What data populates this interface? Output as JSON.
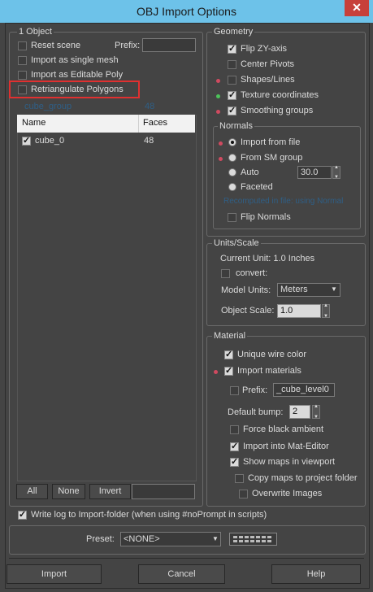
{
  "window": {
    "title": "OBJ Import Options",
    "close_glyph": "✕"
  },
  "objects": {
    "group_label": "1 Object",
    "reset_scene": "Reset scene",
    "prefix_label": "Prefix:",
    "import_single_mesh": "Import as single mesh",
    "import_editable_poly": "Import as Editable Poly",
    "retriangulate": "Retriangulate Polygons",
    "dim_left": "cube_group",
    "dim_right": "48",
    "columns": {
      "name": "Name",
      "faces": "Faces"
    },
    "rows": [
      {
        "name": "cube_0",
        "faces": "48",
        "checked": true
      }
    ],
    "all_btn": "All",
    "none_btn": "None",
    "invert_btn": "Invert"
  },
  "geometry": {
    "group_label": "Geometry",
    "flip_zy": "Flip ZY-axis",
    "center_pivots": "Center Pivots",
    "shapes_lines": "Shapes/Lines",
    "texture_coords": "Texture coordinates",
    "smoothing_groups": "Smoothing groups",
    "normals": {
      "group_label": "Normals",
      "import_from_file": "Import from file",
      "from_sm_group": "From SM group",
      "auto": "Auto",
      "auto_value": "30.0",
      "faceted": "Faceted",
      "dim_note": "Recomputed in file: using Normal",
      "flip_normals": "Flip Normals"
    }
  },
  "units": {
    "group_label": "Units/Scale",
    "current_unit": "Current Unit:  1.0 Inches",
    "convert": "convert:",
    "model_units_label": "Model Units:",
    "model_units_value": "Meters",
    "object_scale_label": "Object Scale:",
    "object_scale_value": "1.0"
  },
  "material": {
    "group_label": "Material",
    "unique_wire": "Unique wire color",
    "import_materials": "Import materials",
    "prefix_label": "Prefix:",
    "prefix_value": "_cube_level0",
    "default_bump_label": "Default bump:",
    "default_bump_value": "2",
    "force_black_ambient": "Force black ambient",
    "import_into_mat_editor": "Import into Mat-Editor",
    "show_maps": "Show maps in viewport",
    "copy_maps": "Copy maps to project folder",
    "overwrite_images": "Overwrite Images"
  },
  "write_log": "Write log to Import-folder (when using #noPrompt in scripts)",
  "preset": {
    "label": "Preset:",
    "value": "<NONE>"
  },
  "buttons": {
    "import": "Import",
    "cancel": "Cancel",
    "help": "Help"
  },
  "colors": {
    "titlebar": "#6dc2e9",
    "close": "#c7403a",
    "highlight": "#e03030",
    "dot_red": "#d04a60",
    "dot_green": "#4cc35a"
  }
}
